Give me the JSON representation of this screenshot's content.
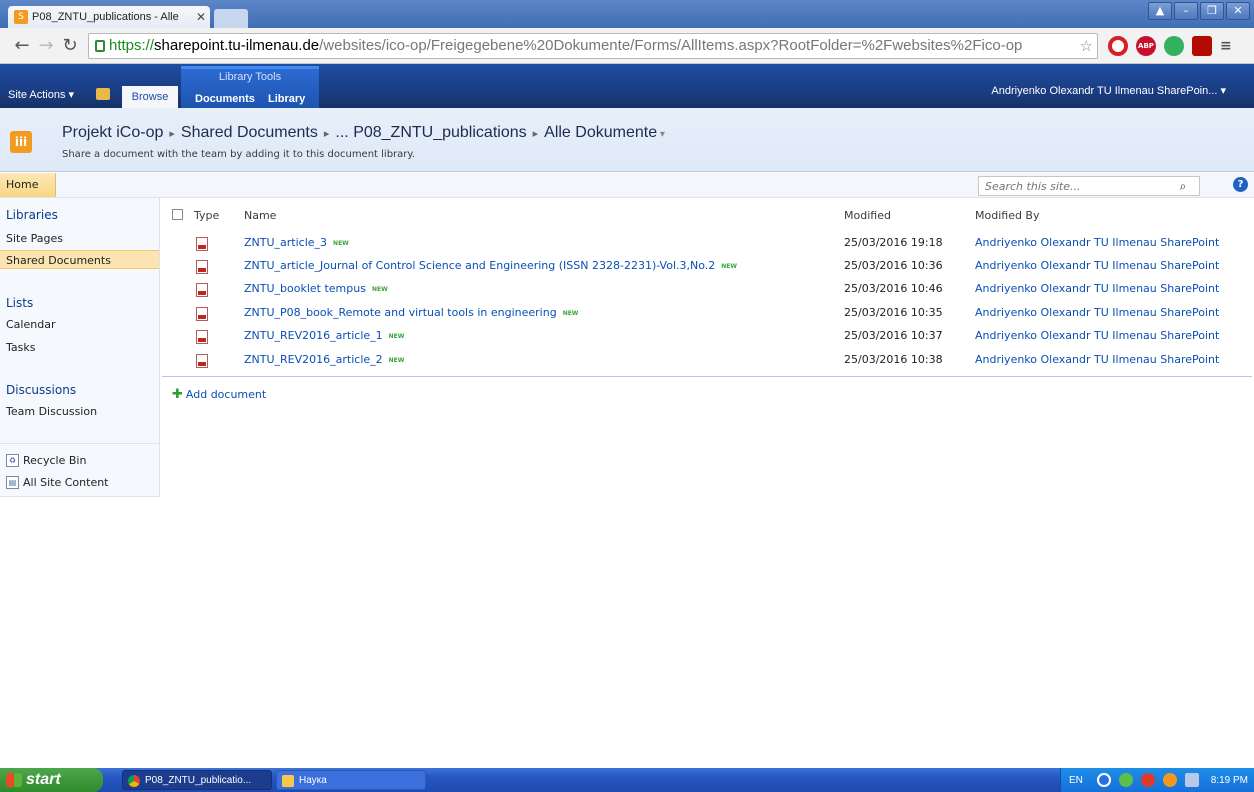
{
  "browser": {
    "tab_title": "P08_ZNTU_publications - Alle",
    "url_scheme": "https://",
    "url_host": "sharepoint.tu-ilmenau.de",
    "url_path": "/websites/ico-op/Freigegebene%20Dokumente/Forms/AllItems.aspx?RootFolder=%2Fwebsites%2Fico-op",
    "window_controls": [
      "▲",
      "–",
      "❐",
      "✕"
    ]
  },
  "ribbon": {
    "site_actions": "Site Actions ▾",
    "browse": "Browse",
    "library_tools": "Library Tools",
    "documents": "Documents",
    "library": "Library",
    "user": "Andriyenko Olexandr TU Ilmenau SharePoin... ▾"
  },
  "title_area": {
    "crumbs": [
      "Projekt iCo-op",
      "Shared Documents",
      "... P08_ZNTU_publications",
      "Alle Dokumente"
    ],
    "description": "Share a document with the team by adding it to this document library."
  },
  "topbar": {
    "home": "Home",
    "search_placeholder": "Search this site...",
    "help": "?"
  },
  "leftnav": {
    "libraries": "Libraries",
    "site_pages": "Site Pages",
    "shared_documents": "Shared Documents",
    "lists": "Lists",
    "calendar": "Calendar",
    "tasks": "Tasks",
    "discussions": "Discussions",
    "team_discussion": "Team Discussion",
    "recycle_bin": "Recycle Bin",
    "all_site_content": "All Site Content"
  },
  "doclib": {
    "columns": {
      "type": "Type",
      "name": "Name",
      "modified": "Modified",
      "modified_by": "Modified By"
    },
    "new_label": "NEW",
    "rows": [
      {
        "name": "ZNTU_article_3",
        "modified": "25/03/2016 19:18",
        "by": "Andriyenko Olexandr TU Ilmenau SharePoint"
      },
      {
        "name": "ZNTU_article_Journal of Control Science and Engineering (ISSN 2328-2231)-Vol.3,No.2",
        "modified": "25/03/2016 10:36",
        "by": "Andriyenko Olexandr TU Ilmenau SharePoint"
      },
      {
        "name": "ZNTU_booklet tempus",
        "modified": "25/03/2016 10:46",
        "by": "Andriyenko Olexandr TU Ilmenau SharePoint"
      },
      {
        "name": "ZNTU_P08_book_Remote and virtual tools in engineering",
        "modified": "25/03/2016 10:35",
        "by": "Andriyenko Olexandr TU Ilmenau SharePoint"
      },
      {
        "name": "ZNTU_REV2016_article_1",
        "modified": "25/03/2016 10:37",
        "by": "Andriyenko Olexandr TU Ilmenau SharePoint"
      },
      {
        "name": "ZNTU_REV2016_article_2",
        "modified": "25/03/2016 10:38",
        "by": "Andriyenko Olexandr TU Ilmenau SharePoint"
      }
    ],
    "add_document": "Add document"
  },
  "taskbar": {
    "start": "start",
    "task1": "P08_ZNTU_publicatio...",
    "task2": "Наука",
    "lang": "EN",
    "clock": "8:19 PM"
  }
}
